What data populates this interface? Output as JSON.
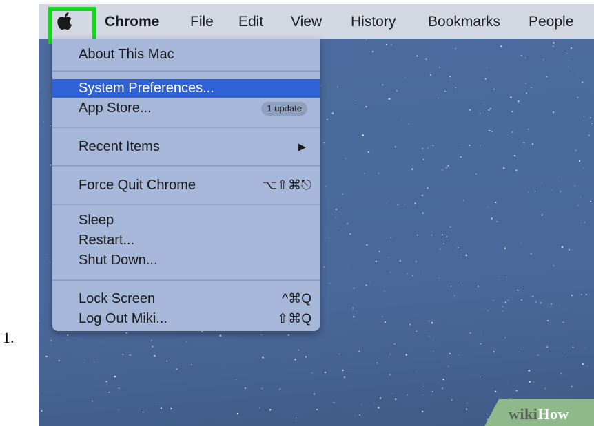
{
  "list_number": "1.",
  "menubar": {
    "items": [
      {
        "label": "Chrome",
        "bold": true
      },
      {
        "label": "File"
      },
      {
        "label": "Edit"
      },
      {
        "label": "View"
      },
      {
        "label": "History"
      },
      {
        "label": "Bookmarks"
      },
      {
        "label": "People"
      }
    ],
    "apple_icon": "apple-logo-icon",
    "highlight_color": "#19d41f"
  },
  "apple_menu": {
    "about": "About This Mac",
    "system_preferences": "System Preferences...",
    "app_store": "App Store...",
    "app_store_badge": "1 update",
    "recent_items": "Recent Items",
    "recent_items_arrow": "▶",
    "force_quit": "Force Quit Chrome",
    "force_quit_shortcut": "⌥⇧⌘⎋",
    "sleep": "Sleep",
    "restart": "Restart...",
    "shut_down": "Shut Down...",
    "lock_screen": "Lock Screen",
    "lock_screen_shortcut": "^⌘Q",
    "log_out": "Log Out Miki...",
    "log_out_shortcut": "⇧⌘Q",
    "selected_color": "#2f62d6"
  },
  "watermark": {
    "wiki": "wiki",
    "how": "How"
  }
}
